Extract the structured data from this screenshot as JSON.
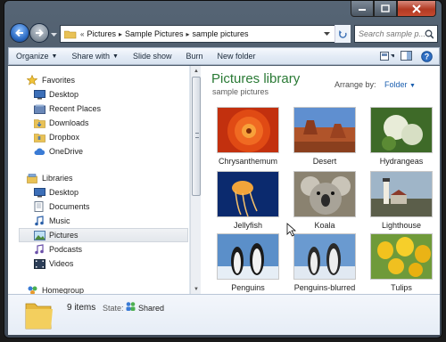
{
  "nav": {
    "breadcrumbs": [
      "Pictures",
      "Sample Pictures",
      "sample pictures"
    ],
    "search_placeholder": "Search sample p..."
  },
  "toolbar": {
    "organize": "Organize",
    "share_with": "Share with",
    "slide_show": "Slide show",
    "burn": "Burn",
    "new_folder": "New folder"
  },
  "sidebar": {
    "favorites": {
      "label": "Favorites",
      "items": [
        "Desktop",
        "Recent Places",
        "Downloads",
        "Dropbox",
        "OneDrive"
      ]
    },
    "libraries": {
      "label": "Libraries",
      "items": [
        "Desktop",
        "Documents",
        "Music",
        "Pictures",
        "Podcasts",
        "Videos"
      ]
    },
    "homegroup": "Homegroup"
  },
  "library": {
    "title": "Pictures library",
    "subtitle": "sample pictures",
    "arrange_label": "Arrange by:",
    "arrange_value": "Folder"
  },
  "files": [
    {
      "name": "Chrysanthemum"
    },
    {
      "name": "Desert"
    },
    {
      "name": "Hydrangeas"
    },
    {
      "name": "Jellyfish"
    },
    {
      "name": "Koala"
    },
    {
      "name": "Lighthouse"
    },
    {
      "name": "Penguins"
    },
    {
      "name": "Penguins-blurred"
    },
    {
      "name": "Tulips"
    }
  ],
  "details": {
    "count": "9 items",
    "state_label": "State:",
    "state_value": "Shared"
  },
  "colors": {
    "title_green": "#2a7a35",
    "link_blue": "#1b5fb0",
    "chrome": "#4c5a69"
  }
}
